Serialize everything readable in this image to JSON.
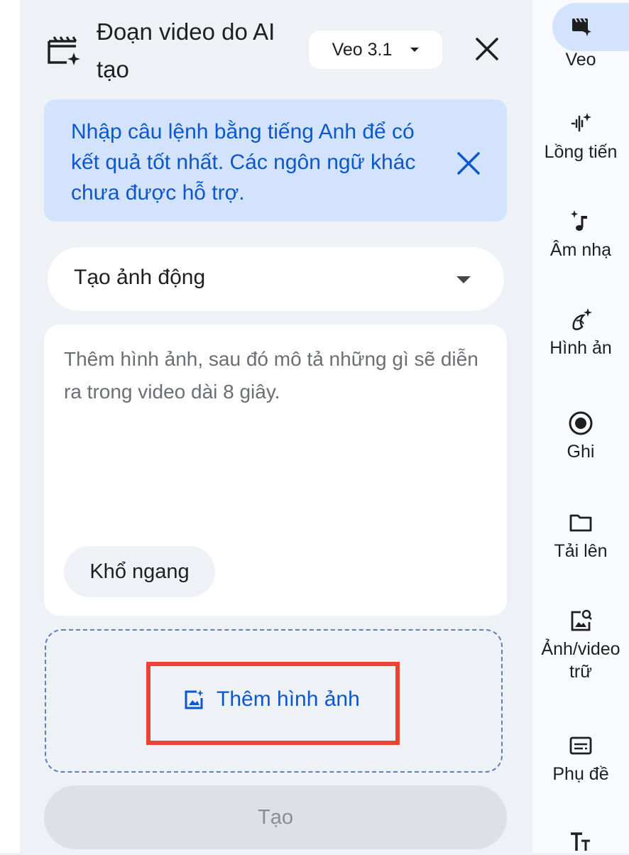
{
  "panel": {
    "title": "Đoạn video do AI tạo",
    "model_select": "Veo 3.1",
    "banner_text": "Nhập câu lệnh bằng tiếng Anh để có kết quả tốt nhất. Các ngôn ngữ khác chưa được hỗ trợ.",
    "mode_select": "Tạo ảnh động",
    "prompt_placeholder": "Thêm hình ảnh, sau đó mô tả những gì sẽ diễn ra trong video dài 8 giây.",
    "aspect_chip": "Khổ ngang",
    "add_image_label": "Thêm hình ảnh",
    "create_button": "Tạo"
  },
  "rail": {
    "items": [
      {
        "label": "Veo",
        "icon": "clapperboard-sparkle-icon"
      },
      {
        "label": "Lồng tiến",
        "icon": "voice-sparkle-icon"
      },
      {
        "label": "Âm nhạ",
        "icon": "music-note-sparkle-icon"
      },
      {
        "label": "Hình ản",
        "icon": "banana-sparkle-icon"
      },
      {
        "label": "Ghi",
        "icon": "record-icon"
      },
      {
        "label": "Tải lên",
        "icon": "folder-icon"
      },
      {
        "label": "Ảnh/video",
        "label2": "trữ",
        "icon": "image-search-icon"
      },
      {
        "label": "Phụ đề",
        "icon": "subtitles-icon"
      },
      {
        "label": "",
        "icon": "text-style-icon"
      }
    ]
  },
  "colors": {
    "accent": "#0b57d0",
    "banner_bg": "#d3e3fd",
    "panel_bg": "#eef1f6",
    "highlight": "#ea4335"
  }
}
